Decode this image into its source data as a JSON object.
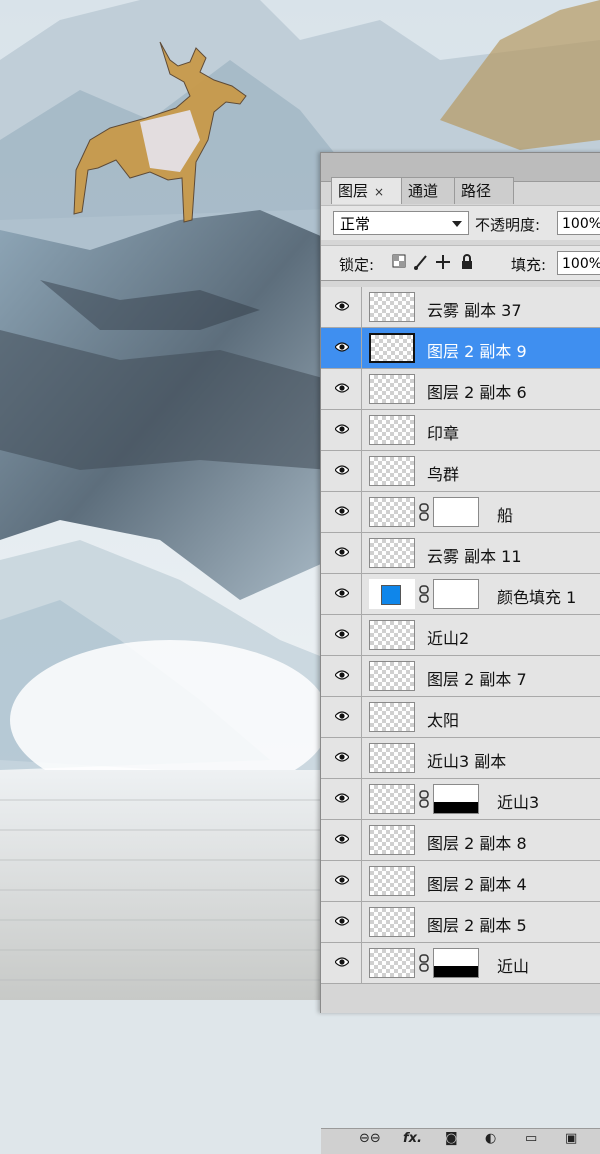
{
  "panel": {
    "tabs": [
      {
        "label": "图层",
        "close": "×"
      },
      {
        "label": "通道"
      },
      {
        "label": "路径"
      }
    ],
    "blend_mode": "正常",
    "opacity_label": "不透明度:",
    "opacity_value": "100%",
    "lock_label": "锁定:",
    "fill_label": "填充:",
    "fill_value": "100%"
  },
  "layers": [
    {
      "name": "云雾 副本 37"
    },
    {
      "name": "图层 2 副本 9",
      "selected": true
    },
    {
      "name": "图层 2 副本 6"
    },
    {
      "name": "印章"
    },
    {
      "name": "鸟群"
    },
    {
      "name": "船",
      "mask": true
    },
    {
      "name": "云雾 副本 11"
    },
    {
      "name": "颜色填充 1",
      "fill_swatch": "#0f86ea",
      "mask": true
    },
    {
      "name": "近山2"
    },
    {
      "name": "图层 2 副本 7"
    },
    {
      "name": "太阳"
    },
    {
      "name": "近山3 副本"
    },
    {
      "name": "近山3",
      "mask": true
    },
    {
      "name": "图层 2 副本 8"
    },
    {
      "name": "图层 2 副本 4"
    },
    {
      "name": "图层 2 副本 5"
    },
    {
      "name": "近山",
      "mask": true
    }
  ],
  "bottom_bar": {
    "link": "⊖⊖",
    "fx": "fx.",
    "icons": [
      "mask-icon",
      "adjustment-icon",
      "group-folder-icon",
      "new-layer-icon"
    ]
  },
  "colors": {
    "selection": "#3f8ff0",
    "fill_swatch": "#0f86ea"
  }
}
